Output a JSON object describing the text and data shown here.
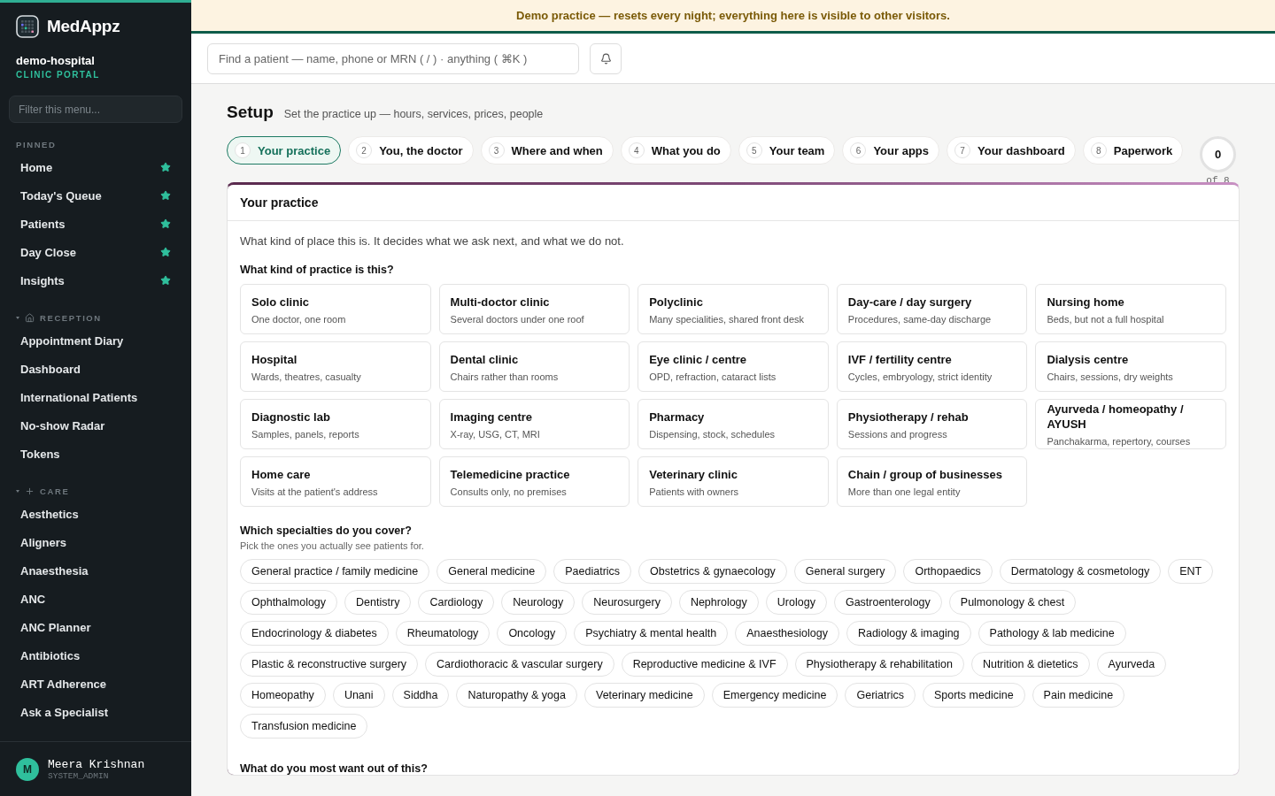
{
  "sidebar": {
    "brand": "MedAppz",
    "org": "demo-hospital",
    "portal": "CLINIC PORTAL",
    "filter_placeholder": "Filter this menu...",
    "sections": [
      {
        "title": "PINNED",
        "kind": "pinned",
        "items": [
          {
            "label": "Home",
            "pinned": true
          },
          {
            "label": "Today's Queue",
            "pinned": true
          },
          {
            "label": "Patients",
            "pinned": true
          },
          {
            "label": "Day Close",
            "pinned": true
          },
          {
            "label": "Insights",
            "pinned": true
          }
        ]
      },
      {
        "title": "RECEPTION",
        "kind": "reception",
        "expanded": true,
        "items": [
          {
            "label": "Appointment Diary",
            "pinned": false
          },
          {
            "label": "Dashboard",
            "pinned": false
          },
          {
            "label": "International Patients",
            "pinned": false
          },
          {
            "label": "No-show Radar",
            "pinned": false
          },
          {
            "label": "Tokens",
            "pinned": false
          }
        ]
      },
      {
        "title": "CARE",
        "kind": "care",
        "expanded": true,
        "items": [
          {
            "label": "Aesthetics",
            "pinned": false
          },
          {
            "label": "Aligners",
            "pinned": false
          },
          {
            "label": "Anaesthesia",
            "pinned": false
          },
          {
            "label": "ANC",
            "pinned": false
          },
          {
            "label": "ANC Planner",
            "pinned": false
          },
          {
            "label": "Antibiotics",
            "pinned": false
          },
          {
            "label": "ART Adherence",
            "pinned": false
          },
          {
            "label": "Ask a Specialist",
            "pinned": false
          }
        ]
      }
    ],
    "user": {
      "initial": "M",
      "name": "Meera Krishnan",
      "role": "SYSTEM_ADMIN"
    }
  },
  "banner": "Demo practice — resets every night; everything here is visible to other visitors.",
  "search": {
    "placeholder": "Find a patient — name, phone or MRN ( / ) · anything ( ⌘K )"
  },
  "page": {
    "title": "Setup",
    "subtitle": "Set the practice up — hours, services, prices, people"
  },
  "steps": [
    {
      "number": "1",
      "label": "Your practice",
      "selected": true
    },
    {
      "number": "2",
      "label": "You, the doctor",
      "selected": false
    },
    {
      "number": "3",
      "label": "Where and when",
      "selected": false
    },
    {
      "number": "4",
      "label": "What you do",
      "selected": false
    },
    {
      "number": "5",
      "label": "Your team",
      "selected": false
    },
    {
      "number": "6",
      "label": "Your apps",
      "selected": false
    },
    {
      "number": "7",
      "label": "Your dashboard",
      "selected": false
    },
    {
      "number": "8",
      "label": "Paperwork",
      "selected": false
    }
  ],
  "progress": {
    "done": "0",
    "total": "of 8"
  },
  "card": {
    "title": "Your practice",
    "intro": "What kind of place this is. It decides what we ask next, and what we do not.",
    "practice_question": "What kind of practice is this?",
    "practice_types": [
      {
        "title": "Solo clinic",
        "hint": "One doctor, one room",
        "selected": false
      },
      {
        "title": "Multi-doctor clinic",
        "hint": "Several doctors under one roof",
        "selected": false
      },
      {
        "title": "Polyclinic",
        "hint": "Many specialities, shared front desk",
        "selected": false
      },
      {
        "title": "Day-care / day surgery",
        "hint": "Procedures, same-day discharge",
        "selected": false
      },
      {
        "title": "Nursing home",
        "hint": "Beds, but not a full hospital",
        "selected": false
      },
      {
        "title": "Hospital",
        "hint": "Wards, theatres, casualty",
        "selected": false
      },
      {
        "title": "Dental clinic",
        "hint": "Chairs rather than rooms",
        "selected": false
      },
      {
        "title": "Eye clinic / centre",
        "hint": "OPD, refraction, cataract lists",
        "selected": false
      },
      {
        "title": "IVF / fertility centre",
        "hint": "Cycles, embryology, strict identity",
        "selected": false
      },
      {
        "title": "Dialysis centre",
        "hint": "Chairs, sessions, dry weights",
        "selected": false
      },
      {
        "title": "Diagnostic lab",
        "hint": "Samples, panels, reports",
        "selected": false
      },
      {
        "title": "Imaging centre",
        "hint": "X-ray, USG, CT, MRI",
        "selected": false
      },
      {
        "title": "Pharmacy",
        "hint": "Dispensing, stock, schedules",
        "selected": false
      },
      {
        "title": "Physiotherapy / rehab",
        "hint": "Sessions and progress",
        "selected": false
      },
      {
        "title": "Ayurveda / homeopathy / AYUSH",
        "hint": "Panchakarma, repertory, courses",
        "selected": false
      },
      {
        "title": "Home care",
        "hint": "Visits at the patient's address",
        "selected": false
      },
      {
        "title": "Telemedicine practice",
        "hint": "Consults only, no premises",
        "selected": false
      },
      {
        "title": "Veterinary clinic",
        "hint": "Patients with owners",
        "selected": false
      },
      {
        "title": "Chain / group of businesses",
        "hint": "More than one legal entity",
        "selected": false
      }
    ],
    "specialty_question": "Which specialties do you cover?",
    "specialty_hint": "Pick the ones you actually see patients for.",
    "specialties": [
      {
        "label": "General practice / family medicine",
        "selected": false
      },
      {
        "label": "General medicine",
        "selected": false
      },
      {
        "label": "Paediatrics",
        "selected": false
      },
      {
        "label": "Obstetrics & gynaecology",
        "selected": false
      },
      {
        "label": "General surgery",
        "selected": false
      },
      {
        "label": "Orthopaedics",
        "selected": false
      },
      {
        "label": "Dermatology & cosmetology",
        "selected": false
      },
      {
        "label": "ENT",
        "selected": false
      },
      {
        "label": "Ophthalmology",
        "selected": false
      },
      {
        "label": "Dentistry",
        "selected": false
      },
      {
        "label": "Cardiology",
        "selected": false
      },
      {
        "label": "Neurology",
        "selected": false
      },
      {
        "label": "Neurosurgery",
        "selected": false
      },
      {
        "label": "Nephrology",
        "selected": false
      },
      {
        "label": "Urology",
        "selected": false
      },
      {
        "label": "Gastroenterology",
        "selected": false
      },
      {
        "label": "Pulmonology & chest",
        "selected": false
      },
      {
        "label": "Endocrinology & diabetes",
        "selected": false
      },
      {
        "label": "Rheumatology",
        "selected": false
      },
      {
        "label": "Oncology",
        "selected": false
      },
      {
        "label": "Psychiatry & mental health",
        "selected": false
      },
      {
        "label": "Anaesthesiology",
        "selected": false
      },
      {
        "label": "Radiology & imaging",
        "selected": false
      },
      {
        "label": "Pathology & lab medicine",
        "selected": false
      },
      {
        "label": "Plastic & reconstructive surgery",
        "selected": false
      },
      {
        "label": "Cardiothoracic & vascular surgery",
        "selected": false
      },
      {
        "label": "Reproductive medicine & IVF",
        "selected": false
      },
      {
        "label": "Physiotherapy & rehabilitation",
        "selected": false
      },
      {
        "label": "Nutrition & dietetics",
        "selected": false
      },
      {
        "label": "Ayurveda",
        "selected": false
      },
      {
        "label": "Homeopathy",
        "selected": false
      },
      {
        "label": "Unani",
        "selected": false
      },
      {
        "label": "Siddha",
        "selected": false
      },
      {
        "label": "Naturopathy & yoga",
        "selected": false
      },
      {
        "label": "Veterinary medicine",
        "selected": false
      },
      {
        "label": "Emergency medicine",
        "selected": false
      },
      {
        "label": "Geriatrics",
        "selected": false
      },
      {
        "label": "Sports medicine",
        "selected": false
      },
      {
        "label": "Pain medicine",
        "selected": false
      },
      {
        "label": "Transfusion medicine",
        "selected": false
      }
    ],
    "goal_question": "What do you most want out of this?"
  }
}
